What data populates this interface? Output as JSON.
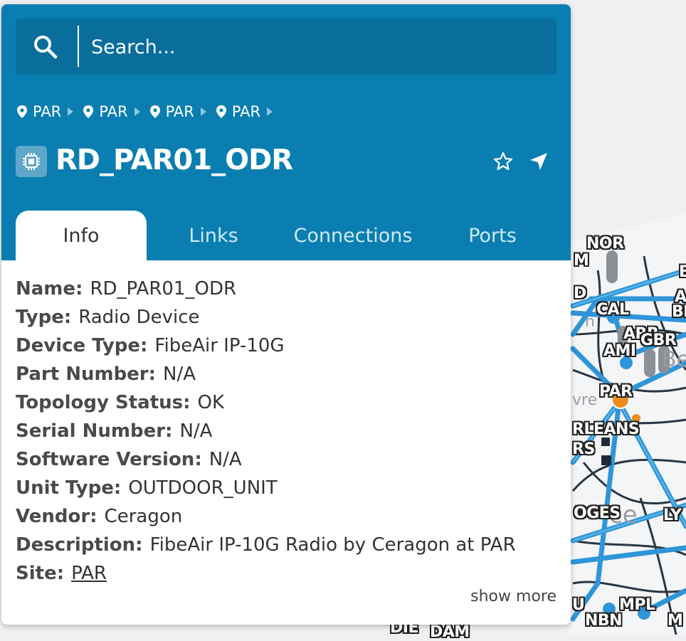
{
  "search": {
    "placeholder": "Search..."
  },
  "breadcrumb": [
    {
      "label": "PAR"
    },
    {
      "label": "PAR"
    },
    {
      "label": "PAR"
    },
    {
      "label": "PAR"
    }
  ],
  "device": {
    "title": "RD_PAR01_ODR"
  },
  "tabs": [
    {
      "label": "Info",
      "active": true
    },
    {
      "label": "Links",
      "active": false
    },
    {
      "label": "Connections",
      "active": false
    },
    {
      "label": "Ports",
      "active": false
    }
  ],
  "info": [
    {
      "key": "Name:",
      "value": "RD_PAR01_ODR"
    },
    {
      "key": "Type:",
      "value": "Radio Device"
    },
    {
      "key": "Device Type:",
      "value": "FibeAir IP-10G"
    },
    {
      "key": "Part Number:",
      "value": "N/A"
    },
    {
      "key": "Topology Status:",
      "value": "OK"
    },
    {
      "key": "Serial Number:",
      "value": "N/A"
    },
    {
      "key": "Software Version:",
      "value": "N/A"
    },
    {
      "key": "Unit Type:",
      "value": "OUTDOOR_UNIT"
    },
    {
      "key": "Vendor:",
      "value": "Ceragon"
    },
    {
      "key": "Description:",
      "value": "FibeAir IP-10G Radio by Ceragon at PAR"
    },
    {
      "key": "Site:",
      "value": "PAR",
      "link": true
    }
  ],
  "show_more": "show more",
  "map": {
    "labels": [
      "NOR",
      "M",
      "CAL",
      "ARR",
      "GBR",
      "AMI",
      "PAR",
      "RLEANS",
      "RS",
      "OGES",
      "LY",
      "NBN",
      "MPL",
      "BE",
      "D",
      "A",
      "B",
      "U",
      "M",
      "DIE",
      "DAM"
    ],
    "faded_labels": [
      "Be",
      "vre",
      "ce",
      "n"
    ]
  },
  "colors": {
    "header": "#0a7eb0",
    "search_bg": "#0a6e9c",
    "link_line": "#2f95d9",
    "map_bg": "#eef0f2",
    "node_orange": "#f08c1e"
  }
}
